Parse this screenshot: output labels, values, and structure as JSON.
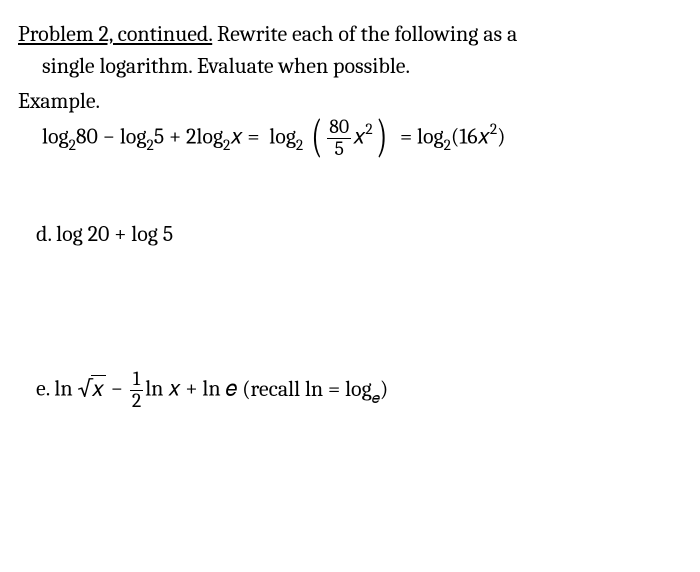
{
  "heading_underline": "Problem 2, continued.",
  "heading_rest": " Rewrite each of the following as a",
  "heading_line2": "single logarithm. Evaluate when possible.",
  "example_label": "Example.",
  "eq": {
    "t1": "log",
    "b1": "2",
    "n1": "80",
    "minus": " − ",
    "t2": "log",
    "b2": "2",
    "n2": "5",
    "plus": " + ",
    "coef": "2",
    "t3": "log",
    "b3": "2",
    "var": "𝑥",
    "eqs": " = ",
    "t4": "log",
    "b4": "2",
    "frac_num": "80",
    "frac_den": "5",
    "xsq_x": "𝑥",
    "xsq_p": "2",
    "t5": "log",
    "b5": "2",
    "res_coef": "16",
    "res_x": "𝑥",
    "res_p": "2"
  },
  "d": {
    "label": "d.  ",
    "t1": "log",
    "sp": " ",
    "n1": "20",
    "plus": " + ",
    "t2": "log",
    "n2": "5"
  },
  "e": {
    "label": "e.  ",
    "ln1": "ln",
    "sp": " ",
    "sqrt_arg": "𝑥",
    "minus": " − ",
    "frac_num": "1",
    "frac_den": "2",
    "ln2": "ln",
    "x2": "𝑥",
    "plus": " + ",
    "ln3": "ln",
    "ee": "𝑒",
    "recall_pre": "   (recall  ",
    "rl": "ln",
    "req": " = ",
    "rt": "log",
    "rb": "𝑒",
    "recall_post": ")"
  }
}
